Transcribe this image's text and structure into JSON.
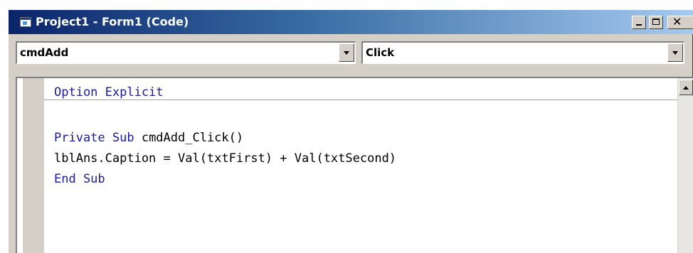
{
  "window": {
    "title": "Project1 - Form1 (Code)",
    "icon": "vb-form-icon",
    "buttons": {
      "minimize": "minimize-icon",
      "maximize": "maximize-icon",
      "close": "close-icon"
    }
  },
  "toolbar": {
    "object_value": "cmdAdd",
    "procedure_value": "Click"
  },
  "code": {
    "declarations": [
      {
        "kw": "Option Explicit",
        "rest": ""
      }
    ],
    "lines": [
      {
        "kw": "Private Sub",
        "rest": " cmdAdd_Click()"
      },
      {
        "kw": "",
        "rest": "lblAns.Caption = Val(txtFirst) + Val(txtSecond)"
      },
      {
        "kw": "End Sub",
        "rest": ""
      }
    ]
  },
  "colors": {
    "keyword": "#1a1a9a",
    "title_bar_start": "#0a246a",
    "title_bar_end": "#a6caf0",
    "chrome": "#d4d0c8"
  }
}
